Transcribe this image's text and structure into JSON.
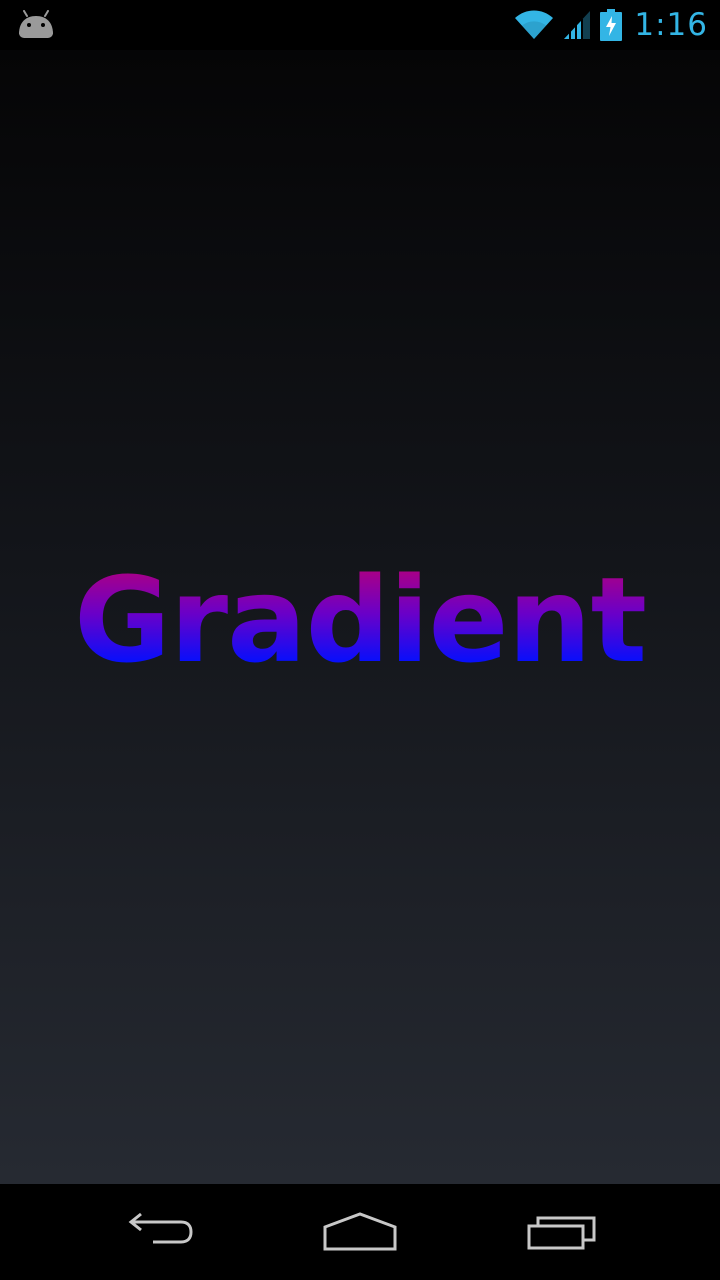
{
  "status_bar": {
    "time": "1:16",
    "icons": [
      "android-icon",
      "wifi-icon",
      "signal-icon",
      "battery-charging-icon"
    ],
    "accent_color": "#33b5e5"
  },
  "main": {
    "text": "Gradient",
    "gradient_colors": [
      "#c0006e",
      "#0000ff"
    ],
    "background_colors": [
      "#050506",
      "#262a32"
    ]
  },
  "nav_bar": {
    "buttons": [
      "back-icon",
      "home-icon",
      "recents-icon"
    ]
  }
}
